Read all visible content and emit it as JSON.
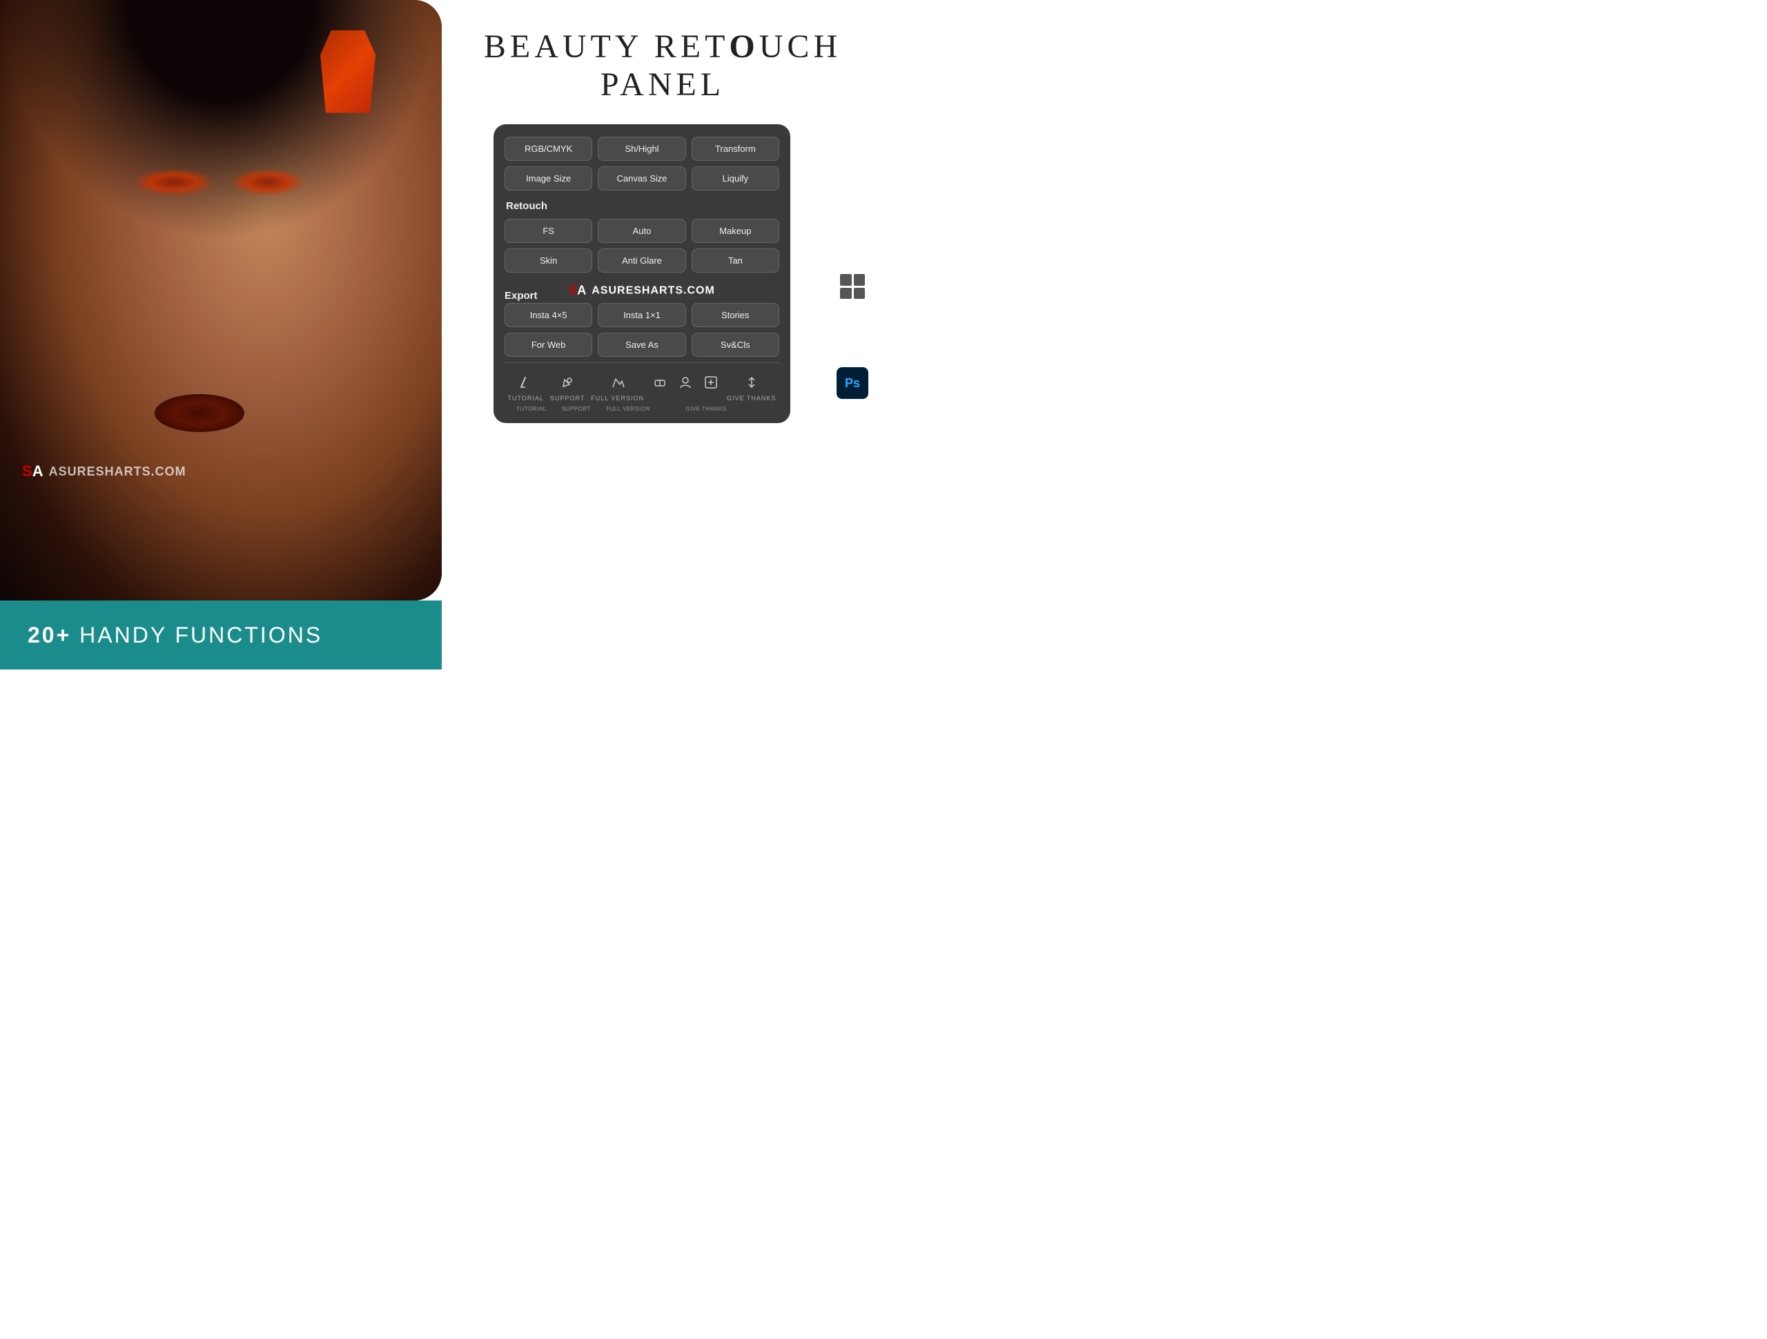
{
  "title": {
    "line1_pre": "BEAUTY RET",
    "line1_bold": "O",
    "line1_post": "UCH",
    "line2": "PANEL"
  },
  "watermark": {
    "text": "ASURESHARTS.COM",
    "logo_s": "S",
    "logo_a": "A"
  },
  "bottom_bar": {
    "text_pre": "20+",
    "text_post": " HANDY FUNCTIONS"
  },
  "panel": {
    "row1": [
      {
        "label": "RGB/CMYK"
      },
      {
        "label": "Sh/Highl"
      },
      {
        "label": "Transform"
      }
    ],
    "row2": [
      {
        "label": "Image Size"
      },
      {
        "label": "Canvas Size"
      },
      {
        "label": "Liquify"
      }
    ],
    "retouch_label": "Retouch",
    "row3": [
      {
        "label": "FS"
      },
      {
        "label": "Auto"
      },
      {
        "label": "Makeup"
      }
    ],
    "row4": [
      {
        "label": "Skin"
      },
      {
        "label": "Anti Glare"
      },
      {
        "label": "Tan"
      }
    ],
    "export_label": "Export",
    "row5": [
      {
        "label": "Insta 4×5"
      },
      {
        "label": "Insta 1×1"
      },
      {
        "label": "Stories"
      }
    ],
    "row6": [
      {
        "label": "For Web"
      },
      {
        "label": "Save As"
      },
      {
        "label": "Sv&Cls"
      }
    ],
    "toolbar": [
      {
        "icon": "✏️",
        "label": "TUTORIAL",
        "unicode": "✏"
      },
      {
        "icon": "🔖",
        "label": "SUPPORT",
        "unicode": "✒"
      },
      {
        "icon": "🖌",
        "label": "FULL VERSION",
        "unicode": "⚡"
      },
      {
        "icon": "🩹",
        "label": "",
        "unicode": "⊞"
      },
      {
        "icon": "👤",
        "label": "GIVE THANKS",
        "unicode": "♦"
      },
      {
        "icon": "+",
        "label": "",
        "unicode": "⊕"
      },
      {
        "icon": "Y",
        "label": "",
        "unicode": "Ψ"
      }
    ]
  }
}
